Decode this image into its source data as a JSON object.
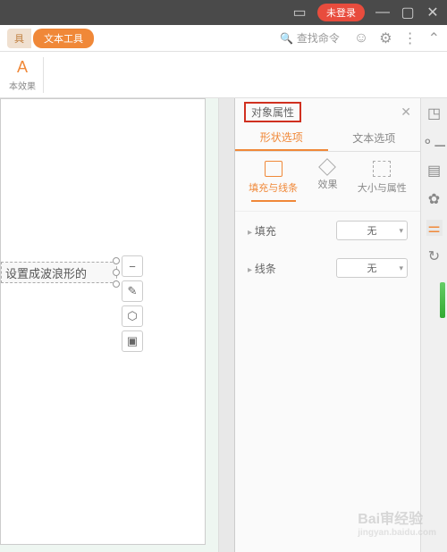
{
  "titlebar": {
    "login_badge": "未登录"
  },
  "toolbar": {
    "tab_other": "具",
    "tab_active": "文本工具",
    "search_placeholder": "查找命令"
  },
  "ribbon": {
    "text_effect": "本效果"
  },
  "canvas": {
    "textbox_content": "设置成波浪形的"
  },
  "panel": {
    "title": "对象属性",
    "tabs": {
      "shape": "形状选项",
      "text": "文本选项"
    },
    "options": {
      "fill_line": "填充与线条",
      "effect": "效果",
      "size_prop": "大小与属性"
    },
    "props": {
      "fill_label": "填充",
      "fill_value": "无",
      "line_label": "线条",
      "line_value": "无"
    }
  },
  "watermark": {
    "main": "Bai审经验",
    "sub": "jingyan.baidu.com"
  }
}
